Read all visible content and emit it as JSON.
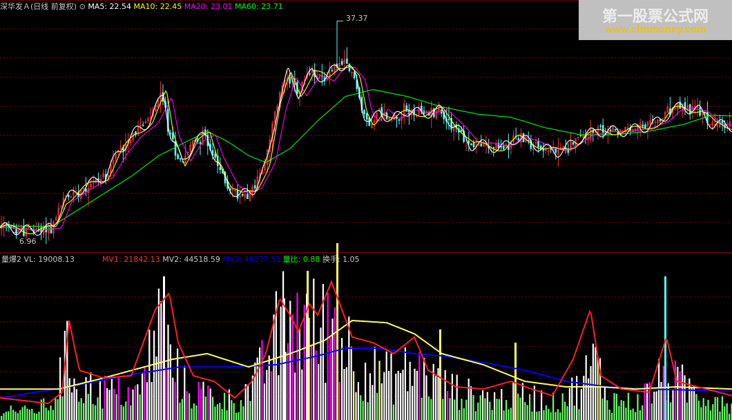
{
  "chart_data": [
    {
      "type": "candlestick",
      "title": "深华发Ａ(日线 前复权)",
      "indicators": [
        {
          "name": "MA5",
          "value": "22.54",
          "color": "#ffffff"
        },
        {
          "name": "MA10",
          "value": "22.45",
          "color": "#ffff00"
        },
        {
          "name": "MA20",
          "value": "23.01",
          "color": "#ff00ff"
        },
        {
          "name": "MA60",
          "value": "23.71",
          "color": "#00ff00"
        }
      ],
      "high_marker": "37.37",
      "low_marker": "6.96",
      "ylim": [
        5,
        39
      ],
      "price_path": [
        [
          0,
          7.6
        ],
        [
          40,
          7.2
        ],
        [
          75,
          7.5
        ],
        [
          90,
          11.5
        ],
        [
          120,
          13.5
        ],
        [
          150,
          15
        ],
        [
          170,
          18.5
        ],
        [
          190,
          21
        ],
        [
          215,
          23
        ],
        [
          235,
          27
        ],
        [
          245,
          21
        ],
        [
          262,
          17
        ],
        [
          280,
          20
        ],
        [
          298,
          21
        ],
        [
          310,
          17.5
        ],
        [
          330,
          13.5
        ],
        [
          345,
          12.2
        ],
        [
          365,
          13
        ],
        [
          385,
          17
        ],
        [
          400,
          25
        ],
        [
          415,
          30
        ],
        [
          430,
          27
        ],
        [
          450,
          30
        ],
        [
          470,
          29
        ],
        [
          485,
          31
        ],
        [
          500,
          31
        ],
        [
          515,
          29
        ],
        [
          525,
          24
        ],
        [
          535,
          22.5
        ],
        [
          548,
          24.5
        ],
        [
          565,
          23
        ],
        [
          585,
          24.5
        ],
        [
          610,
          24
        ],
        [
          635,
          24.5
        ],
        [
          660,
          22
        ],
        [
          680,
          19.5
        ],
        [
          700,
          19.5
        ],
        [
          725,
          19
        ],
        [
          745,
          20.5
        ],
        [
          765,
          20
        ],
        [
          785,
          19
        ],
        [
          805,
          18.5
        ],
        [
          825,
          19.5
        ],
        [
          845,
          21
        ],
        [
          870,
          21.5
        ],
        [
          900,
          21.5
        ],
        [
          930,
          22
        ],
        [
          955,
          23
        ],
        [
          970,
          24.5
        ],
        [
          985,
          25
        ],
        [
          1010,
          24.5
        ],
        [
          1030,
          22.5
        ],
        [
          1060,
          22.2
        ]
      ],
      "ma60_path": [
        [
          0,
          7.9
        ],
        [
          75,
          7.8
        ],
        [
          110,
          10
        ],
        [
          150,
          12.5
        ],
        [
          190,
          15
        ],
        [
          230,
          18
        ],
        [
          270,
          20
        ],
        [
          300,
          21.5
        ],
        [
          330,
          20
        ],
        [
          360,
          18
        ],
        [
          385,
          17
        ],
        [
          420,
          19
        ],
        [
          460,
          23
        ],
        [
          500,
          26.5
        ],
        [
          540,
          27.5
        ],
        [
          590,
          26.5
        ],
        [
          640,
          25
        ],
        [
          690,
          24
        ],
        [
          740,
          23.5
        ],
        [
          790,
          22
        ],
        [
          840,
          21
        ],
        [
          890,
          21
        ],
        [
          940,
          21.5
        ],
        [
          990,
          22.5
        ],
        [
          1030,
          23.8
        ],
        [
          1060,
          23.7
        ]
      ],
      "colors": {
        "up": "#ff3232",
        "down": "#54ffff",
        "ma5": "#ffffff",
        "ma10": "#ffff00",
        "ma20": "#ff00ff",
        "ma60": "#00ff00"
      }
    },
    {
      "type": "bar",
      "title": "量爆2",
      "indicators": [
        {
          "name": "VL",
          "value": "19008.13",
          "color": "#c8c8c8"
        },
        {
          "name": "MV1",
          "value": "21842.13",
          "color": "#ff3232"
        },
        {
          "name": "MV2",
          "value": "44518.59",
          "color": "#c8c8c8"
        },
        {
          "name": "MV3",
          "value": "46877.51",
          "color": "#0000ff"
        },
        {
          "name": "量比",
          "value": "0.88",
          "color": "#00ff00"
        },
        {
          "name": "换手",
          "value": "1.05",
          "color": "#c8c8c8"
        }
      ],
      "vol_path": [
        [
          0,
          15
        ],
        [
          40,
          10
        ],
        [
          75,
          20
        ],
        [
          95,
          75
        ],
        [
          115,
          40
        ],
        [
          150,
          35
        ],
        [
          200,
          30
        ],
        [
          232,
          120
        ],
        [
          245,
          70
        ],
        [
          270,
          35
        ],
        [
          300,
          30
        ],
        [
          340,
          22
        ],
        [
          370,
          45
        ],
        [
          390,
          80
        ],
        [
          410,
          115
        ],
        [
          440,
          120
        ],
        [
          460,
          100
        ],
        [
          480,
          125
        ],
        [
          500,
          90
        ],
        [
          530,
          60
        ],
        [
          560,
          50
        ],
        [
          600,
          60
        ],
        [
          640,
          40
        ],
        [
          680,
          30
        ],
        [
          720,
          25
        ],
        [
          760,
          30
        ],
        [
          800,
          20
        ],
        [
          840,
          40
        ],
        [
          860,
          70
        ],
        [
          880,
          25
        ],
        [
          920,
          20
        ],
        [
          960,
          50
        ],
        [
          990,
          40
        ],
        [
          1020,
          30
        ],
        [
          1060,
          22
        ]
      ],
      "yellow_path": [
        [
          0,
          28
        ],
        [
          85,
          28
        ],
        [
          150,
          38
        ],
        [
          250,
          55
        ],
        [
          300,
          60
        ],
        [
          360,
          48
        ],
        [
          420,
          60
        ],
        [
          470,
          72
        ],
        [
          510,
          90
        ],
        [
          560,
          88
        ],
        [
          600,
          78
        ],
        [
          640,
          60
        ],
        [
          700,
          50
        ],
        [
          760,
          35
        ],
        [
          820,
          30
        ],
        [
          870,
          30
        ],
        [
          920,
          28
        ],
        [
          980,
          30
        ],
        [
          1060,
          28
        ]
      ],
      "blue_path": [
        [
          0,
          20
        ],
        [
          100,
          30
        ],
        [
          180,
          40
        ],
        [
          260,
          48
        ],
        [
          330,
          48
        ],
        [
          400,
          50
        ],
        [
          460,
          58
        ],
        [
          500,
          65
        ],
        [
          550,
          65
        ],
        [
          600,
          60
        ],
        [
          640,
          58
        ],
        [
          700,
          52
        ],
        [
          760,
          45
        ],
        [
          820,
          35
        ],
        [
          880,
          30
        ],
        [
          940,
          28
        ],
        [
          1000,
          27
        ],
        [
          1060,
          26
        ]
      ],
      "red_path": [
        [
          0,
          20
        ],
        [
          70,
          15
        ],
        [
          90,
          25
        ],
        [
          100,
          90
        ],
        [
          115,
          45
        ],
        [
          150,
          38
        ],
        [
          190,
          40
        ],
        [
          225,
          100
        ],
        [
          245,
          115
        ],
        [
          258,
          70
        ],
        [
          280,
          40
        ],
        [
          310,
          35
        ],
        [
          340,
          20
        ],
        [
          365,
          35
        ],
        [
          385,
          60
        ],
        [
          405,
          110
        ],
        [
          420,
          95
        ],
        [
          432,
          80
        ],
        [
          448,
          105
        ],
        [
          460,
          95
        ],
        [
          480,
          125
        ],
        [
          495,
          100
        ],
        [
          510,
          75
        ],
        [
          540,
          70
        ],
        [
          570,
          60
        ],
        [
          600,
          75
        ],
        [
          620,
          45
        ],
        [
          660,
          30
        ],
        [
          700,
          28
        ],
        [
          740,
          35
        ],
        [
          770,
          28
        ],
        [
          800,
          22
        ],
        [
          830,
          55
        ],
        [
          855,
          100
        ],
        [
          870,
          40
        ],
        [
          900,
          28
        ],
        [
          940,
          25
        ],
        [
          965,
          75
        ],
        [
          980,
          35
        ],
        [
          1010,
          30
        ],
        [
          1060,
          22
        ]
      ],
      "colors": {
        "bar": "#ffffff",
        "bar_alt": "#ff00ff",
        "bar_low": "#66ff66",
        "bar_high": "#ffff66"
      }
    }
  ],
  "watermark": {
    "title": "第一股票公式网",
    "url": "www.chnmoney.com"
  }
}
